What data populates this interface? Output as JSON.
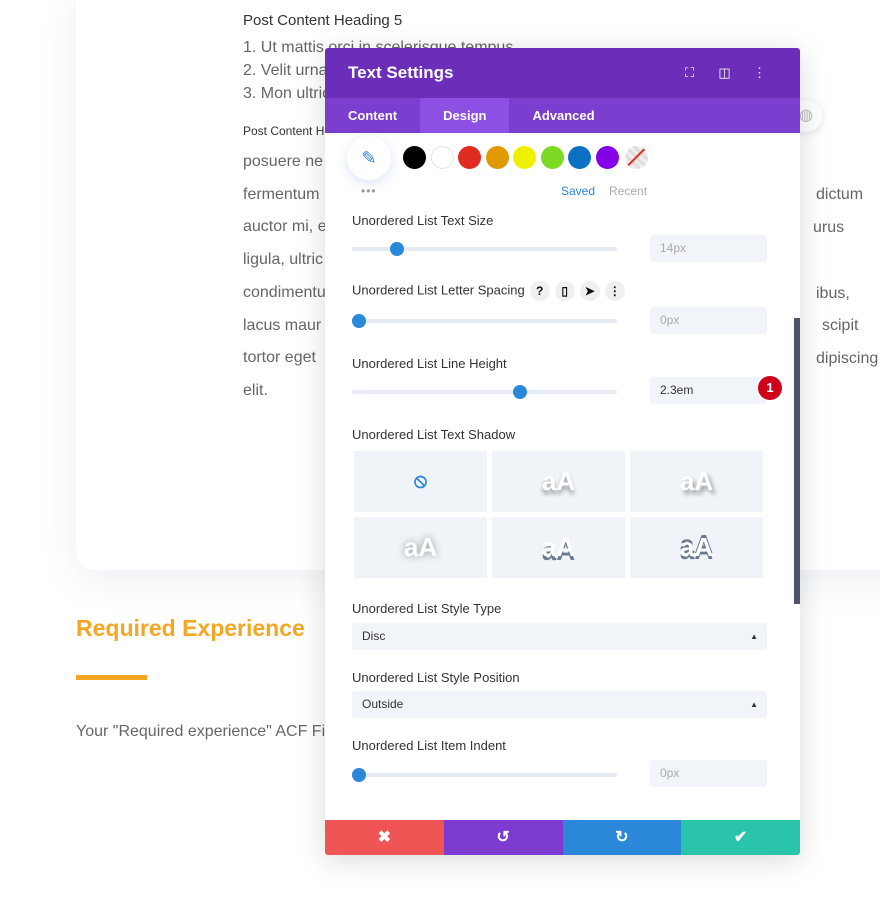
{
  "background": {
    "heading5": "Post Content Heading 5",
    "list": [
      "1. Ut mattis orci in scelerisque tempus",
      "2. Velit urna",
      "3. Mon ultric"
    ],
    "heading6": "Post Content H",
    "para_left": [
      "posuere ne",
      "fermentum",
      "auctor mi, e",
      "ligula, ultric",
      "condimentu",
      "lacus maur",
      "tortor eget",
      "elit."
    ],
    "para_right": [
      "dictum",
      "urus",
      "ibus,",
      "scipit",
      "dipiscing"
    ],
    "required_heading": "Required Experience",
    "acf_text": "Your \"Required experience\" ACF Fi",
    "accent": "#f5a623"
  },
  "modal": {
    "title": "Text Settings",
    "header_icons": [
      "fullscreen-icon",
      "split-view-icon",
      "more-vertical-icon"
    ],
    "tabs": [
      {
        "label": "Content"
      },
      {
        "label": "Design",
        "active": true
      },
      {
        "label": "Advanced"
      }
    ],
    "palette": {
      "colors": [
        "#000000",
        "#ffffff",
        "#e02b20",
        "#e09900",
        "#edf000",
        "#7cda24",
        "#0c71c3",
        "#8300e9"
      ],
      "saved": "Saved",
      "recent": "Recent",
      "more": "•••"
    },
    "text_size": {
      "label": "Unordered List Text Size",
      "value": "14px",
      "slider": 0.15
    },
    "letter_spacing": {
      "label": "Unordered List Letter Spacing",
      "value": "0px",
      "slider": 0
    },
    "line_height": {
      "label": "Unordered List Line Height",
      "value": "2.3em",
      "slider": 0.64,
      "badge": "1"
    },
    "text_shadow": {
      "label": "Unordered List Text Shadow",
      "sample": "aA"
    },
    "style_type": {
      "label": "Unordered List Style Type",
      "value": "Disc"
    },
    "style_position": {
      "label": "Unordered List Style Position",
      "value": "Outside"
    },
    "item_indent": {
      "label": "Unordered List Item Indent",
      "value": "0px",
      "slider": 0
    },
    "footer": {
      "colors": [
        "#ef5555",
        "#7d3bcf",
        "#2b87da",
        "#29c4a9"
      ]
    }
  }
}
